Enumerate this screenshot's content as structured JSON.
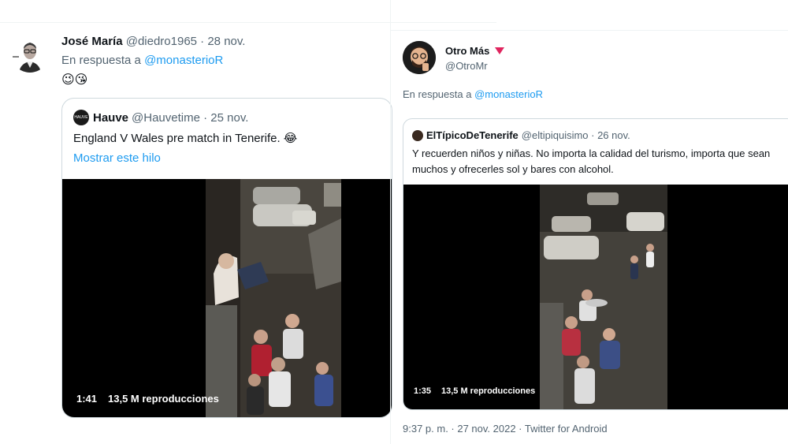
{
  "left_tweet": {
    "author_name": "José María",
    "author_meta": "@diedro1965 · 28 nov.",
    "reply_prefix": "En respuesta a",
    "reply_handle": "@monasterioR",
    "emoji_text": "😉😘",
    "quote": {
      "author_name": "Hauve",
      "author_meta": "@Hauvetime · 25 nov.",
      "avatar_text": "HAUVE",
      "text": "England V Wales pre match in Tenerife. 😂",
      "show_thread": "Mostrar este hilo",
      "video": {
        "duration": "1:41",
        "views": "13,5 M reproducciones"
      }
    }
  },
  "right_tweet": {
    "author_name": "Otro Más",
    "author_handle": "@OtroMr",
    "reply_prefix": "En respuesta a",
    "reply_handle": "@monasterioR",
    "quote": {
      "author_name": "ElTípicoDeTenerife",
      "author_meta": "@eltipiquisimo · 26 nov.",
      "text": "Y recuerden niños y niñas. No importa la calidad del turismo, importa que sean muchos y ofrecerles sol y bares con alcohol.",
      "video": {
        "duration": "1:35",
        "views": "13,5 M reproducciones"
      }
    },
    "footer": "9:37 p. m. · 27 nov. 2022 · Twitter for Android"
  },
  "colors": {
    "link": "#1d9bf0",
    "secondary_text": "#536471",
    "border": "#cfd9de",
    "verified_marker": "#e0245e"
  },
  "icons": [
    "portrait-avatar",
    "memoji-avatar",
    "hauve-logo",
    "red-down-triangle-icon"
  ]
}
